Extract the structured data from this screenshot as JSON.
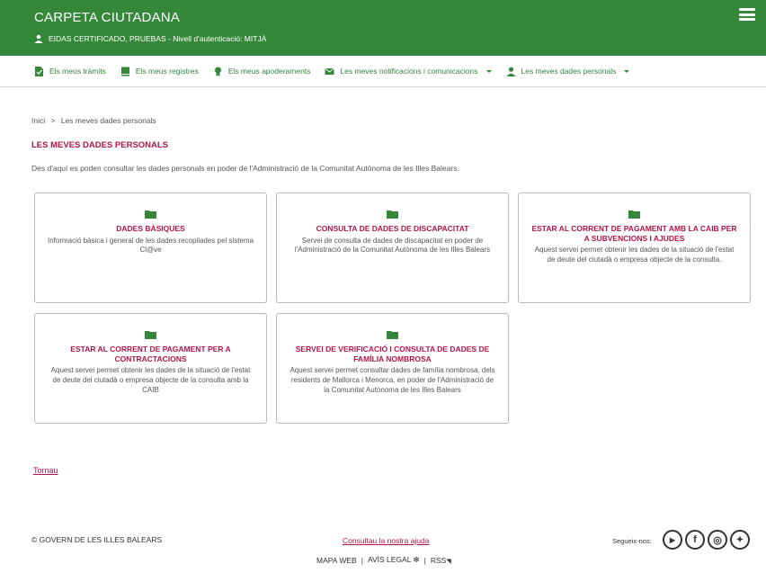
{
  "header": {
    "app_title": "CARPETA CIUTADANA",
    "user_info": "EIDAS CERTIFICADO, PRUEBAS - Nivell d'autenticació: MITJÀ",
    "icons": [
      "user-icon",
      "hamburger-menu-icon"
    ]
  },
  "nav": {
    "items": [
      {
        "label": "Els meus tràmits",
        "icon": "document-icon"
      },
      {
        "label": "Els meus registres",
        "icon": "book-icon"
      },
      {
        "label": "Els meus apoderaments",
        "icon": "award-icon"
      },
      {
        "label": "Les meves notificacions i comunicacions",
        "icon": "envelope-icon",
        "dropdown": true
      },
      {
        "label": "Les meves dades personals",
        "icon": "user-icon",
        "dropdown": true
      }
    ]
  },
  "breadcrumb": {
    "home": "Inici",
    "separator": ">",
    "current": "Les meves dades personals"
  },
  "page": {
    "title": "LES MEVES DADES PERSONALS",
    "intro": "Des d'aquí es poden consultar les dades personals en poder de l'Administració de la Comunitat Autònoma de les Illes Balears."
  },
  "cards": [
    {
      "title": "DADES BÀSIQUES",
      "desc": "Informació bàsica i general de les dades recopilades pel sistema Cl@ve"
    },
    {
      "title": "CONSULTA DE DADES DE DISCAPACITAT",
      "desc": "Servei de consulta de dades de discapacitat en poder de l'Administració de la Comunitat Autònoma de les Illes Balears"
    },
    {
      "title": "ESTAR AL CORRENT DE PAGAMENT AMB LA CAIB PER A SUBVENCIONS I AJUDES",
      "desc": "Aquest servei permet obtenir les dades de la situació de l'estat de deute del ciutadà o empresa objecte de la consulta."
    },
    {
      "title": "ESTAR AL CORRENT DE PAGAMENT PER A CONTRACTACIONS",
      "desc": "Aquest servei permet obtenir les dades de la situació de l'estat de deute del ciutadà o empresa objecte de la consulta amb la CAIB"
    },
    {
      "title": "SERVEI DE VERIFICACIÓ I CONSULTA DE DADES DE FAMÍLIA NOMBROSA",
      "desc": "Aquest servei permet consultar dades de família nombrosa, dels residents de Mallorca i Menorca, en poder de l'Administració de la Comunitat Autònoma de les Illes Balears"
    }
  ],
  "back_link": "Tornau",
  "footer": {
    "copyright": "© GOVERN DE LES ILLES BALEARS",
    "help": "Consultau la nostra ajuda",
    "links": [
      "MAPA WEB",
      "AVÍS LEGAL",
      "RSS"
    ],
    "separator": "|",
    "social_label": "Segueix-nos:",
    "social": [
      {
        "name": "youtube-icon",
        "glyph": "▶"
      },
      {
        "name": "facebook-icon",
        "glyph": "f"
      },
      {
        "name": "instagram-icon",
        "glyph": "◎"
      },
      {
        "name": "twitter-icon",
        "glyph": "✦"
      }
    ]
  },
  "colors": {
    "brand_green": "#35873a",
    "accent_red": "#b3154a"
  }
}
